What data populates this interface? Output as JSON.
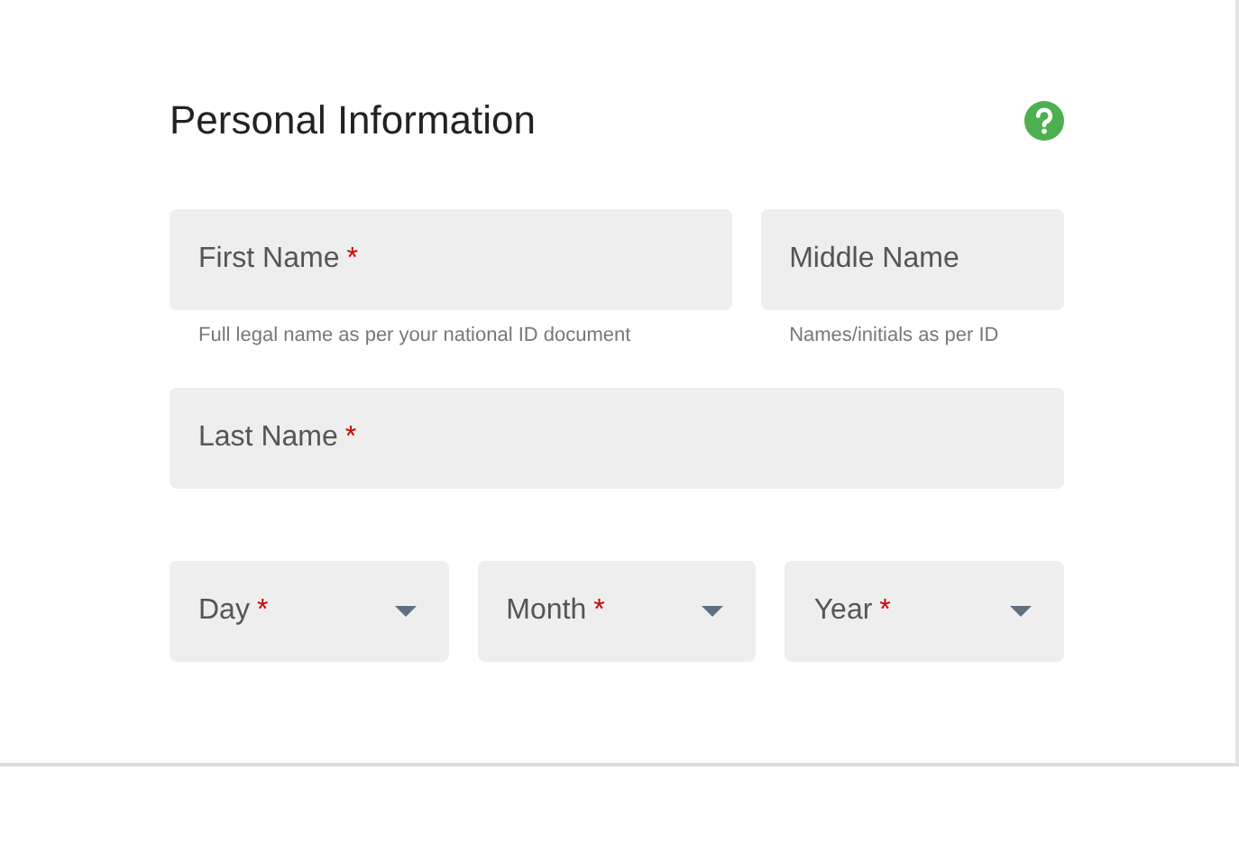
{
  "section": {
    "title": "Personal Information"
  },
  "rows": [
    {
      "fields": [
        {
          "kind": "text",
          "label": "First Name",
          "required_mark": "*",
          "hint": "Full legal name as per your national ID document"
        },
        {
          "kind": "text",
          "label": "Middle Name",
          "hint": "Names/initials as per ID"
        }
      ]
    },
    {
      "fields": [
        {
          "kind": "text",
          "label": "Last Name",
          "required_mark": "*"
        }
      ]
    },
    {
      "fields": [
        {
          "kind": "select",
          "label": "Day",
          "required_mark": "*"
        },
        {
          "kind": "select",
          "label": "Month",
          "required_mark": "*"
        },
        {
          "kind": "select",
          "label": "Year",
          "required_mark": "*"
        }
      ]
    }
  ]
}
